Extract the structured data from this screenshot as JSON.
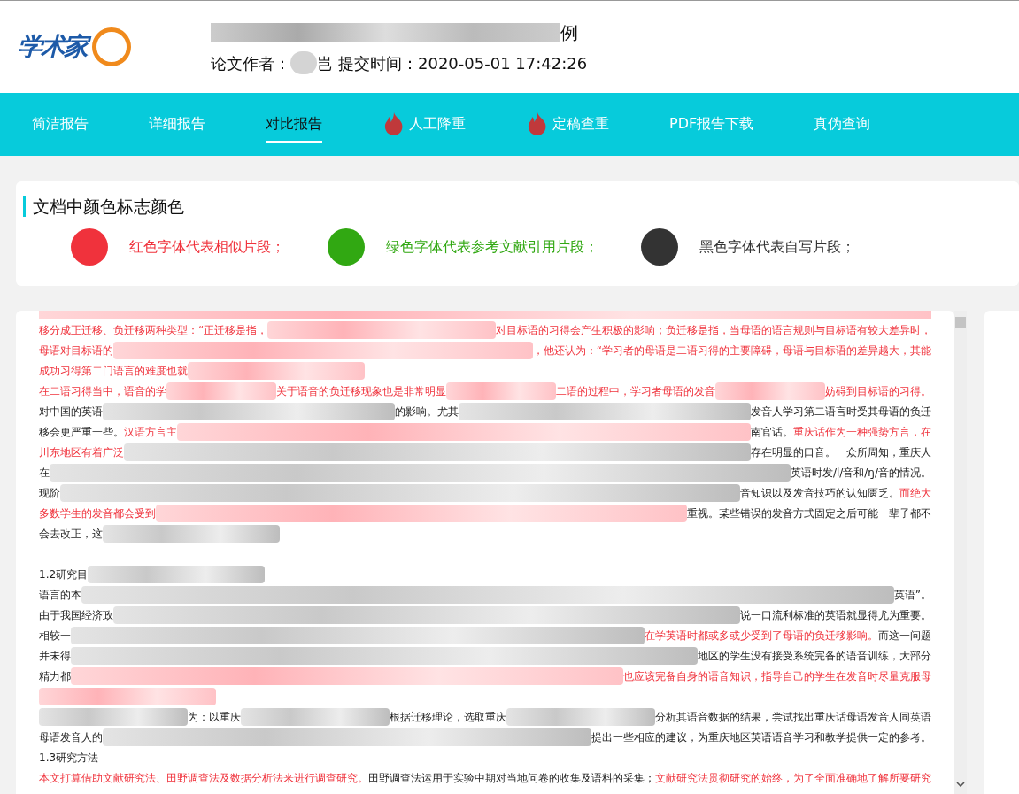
{
  "logo": {
    "text": "学术家"
  },
  "header": {
    "title_tail": "例",
    "author_label": "论文作者：",
    "author_tail": "岂",
    "submit_label": "提交时间：2020-05-01 17:42:26"
  },
  "nav": [
    {
      "label": "简洁报告",
      "selected": false,
      "hot": false
    },
    {
      "label": "详细报告",
      "selected": false,
      "hot": false
    },
    {
      "label": "对比报告",
      "selected": true,
      "hot": false
    },
    {
      "label": "人工降重",
      "selected": false,
      "hot": true
    },
    {
      "label": "定稿查重",
      "selected": false,
      "hot": true
    },
    {
      "label": "PDF报告下载",
      "selected": false,
      "hot": false
    },
    {
      "label": "真伪查询",
      "selected": false,
      "hot": false
    }
  ],
  "legend": {
    "title": "文档中颜色标志颜色",
    "items": [
      {
        "color": "#f0323c",
        "text": "红色字体代表相似片段；"
      },
      {
        "color": "#31a812",
        "text": "绿色字体代表参考文献引用片段；"
      },
      {
        "color": "#333333",
        "text": "黑色字体代表自写片段；"
      }
    ]
  },
  "document": {
    "lines": [
      {
        "kind": "text",
        "segments": [
          {
            "kind": "similar",
            "text": "移分成正迁移、负迁移两种类型：“正迁移是指，"
          },
          {
            "kind": "similar_redaction"
          },
          {
            "kind": "similar",
            "text": "对目标语的习得会产生积极的影响；负迁移是指，当母语的语言规则与目标语有较大差异时，"
          }
        ]
      },
      {
        "kind": "text",
        "segments": [
          {
            "kind": "similar",
            "text": "母语对目标语的"
          },
          {
            "kind": "similar_redaction"
          },
          {
            "kind": "similar",
            "text": "，他还认为：“学习者的母语是二语习得的主要障碍，母语与目标语的差异越大，其能"
          }
        ]
      },
      {
        "kind": "text",
        "segments": [
          {
            "kind": "similar",
            "text": "成功习得第二门语言的难度也就"
          },
          {
            "kind": "similar_redaction"
          }
        ]
      },
      {
        "kind": "text",
        "segments": [
          {
            "kind": "similar",
            "text": "在二语习得当中，语音的学"
          },
          {
            "kind": "similar_redaction"
          },
          {
            "kind": "similar",
            "text": "关于语音的负迁移现象也是非常明显"
          },
          {
            "kind": "similar_redaction"
          },
          {
            "kind": "similar",
            "text": "二语的过程中，学习者母语的发音"
          },
          {
            "kind": "similar_redaction"
          },
          {
            "kind": "similar",
            "text": "妨碍到目标语的习得。"
          }
        ]
      },
      {
        "kind": "text",
        "segments": [
          {
            "kind": "own",
            "text": "对中国的英语"
          },
          {
            "kind": "own_redaction"
          },
          {
            "kind": "own",
            "text": "的影响。尤其"
          },
          {
            "kind": "own_redaction"
          },
          {
            "kind": "own",
            "text": "发音人学习第二语言时受其母语的负迁"
          }
        ]
      },
      {
        "kind": "text",
        "segments": [
          {
            "kind": "own",
            "text": "移会更严重一些。"
          },
          {
            "kind": "similar",
            "text": "汉语方言主"
          },
          {
            "kind": "similar_redaction"
          },
          {
            "kind": "own",
            "text": "南官话。"
          },
          {
            "kind": "similar",
            "text": "重庆话作为一种强势方言，在"
          }
        ]
      },
      {
        "kind": "text",
        "segments": [
          {
            "kind": "similar",
            "text": "川东地区有着广泛"
          },
          {
            "kind": "own_redaction"
          },
          {
            "kind": "own",
            "text": "存在明显的口音。　众所周知，重庆人"
          }
        ]
      },
      {
        "kind": "text",
        "segments": [
          {
            "kind": "own",
            "text": "在"
          },
          {
            "kind": "own_redaction"
          },
          {
            "kind": "own",
            "text": "英语时发/l/音和/ŋ/音的情况。"
          }
        ]
      },
      {
        "kind": "text",
        "segments": [
          {
            "kind": "own",
            "text": "现阶"
          },
          {
            "kind": "own_redaction"
          },
          {
            "kind": "own",
            "text": "音知识以及发音技巧的认知匮乏。"
          },
          {
            "kind": "similar",
            "text": "而绝大"
          }
        ]
      },
      {
        "kind": "text",
        "segments": [
          {
            "kind": "similar",
            "text": "多数学生的发音都会受到"
          },
          {
            "kind": "similar_redaction"
          },
          {
            "kind": "own",
            "text": "重视。某些错误的发音方式固定之后可能一辈子都不"
          }
        ]
      },
      {
        "kind": "text",
        "segments": [
          {
            "kind": "own",
            "text": "会去改正，这"
          },
          {
            "kind": "own_redaction"
          }
        ]
      },
      {
        "kind": "blank"
      },
      {
        "kind": "text",
        "segments": [
          {
            "kind": "own",
            "text": "1.2研究目"
          },
          {
            "kind": "own_redaction"
          }
        ]
      },
      {
        "kind": "text",
        "segments": [
          {
            "kind": "own",
            "text": "语言的本"
          },
          {
            "kind": "own_redaction"
          },
          {
            "kind": "own",
            "text": "英语”。"
          }
        ]
      },
      {
        "kind": "text",
        "segments": [
          {
            "kind": "own",
            "text": "由于我国经济政"
          },
          {
            "kind": "own_redaction"
          },
          {
            "kind": "own",
            "text": "说一口流利标准的英语就显得尤为重要。"
          }
        ]
      },
      {
        "kind": "text",
        "segments": [
          {
            "kind": "own",
            "text": "相较一"
          },
          {
            "kind": "own_redaction"
          },
          {
            "kind": "similar",
            "text": "在学英语时都或多或少受到了母语的负迁移影响。"
          },
          {
            "kind": "own",
            "text": "而这一问题"
          }
        ]
      },
      {
        "kind": "text",
        "segments": [
          {
            "kind": "own",
            "text": "并未得"
          },
          {
            "kind": "own_redaction"
          },
          {
            "kind": "own",
            "text": "地区的学生没有接受系统完备的语音训练，大部分"
          }
        ]
      },
      {
        "kind": "text",
        "segments": [
          {
            "kind": "own",
            "text": "精力都"
          },
          {
            "kind": "similar_redaction"
          },
          {
            "kind": "similar",
            "text": "也应该完备自身的语音知识，指导自己的学生在发音时尽量克服母"
          }
        ]
      },
      {
        "kind": "text",
        "segments": [
          {
            "kind": "similar_redaction"
          }
        ]
      },
      {
        "kind": "text",
        "segments": [
          {
            "kind": "own_redaction"
          },
          {
            "kind": "own",
            "text": "为：以重庆"
          },
          {
            "kind": "own_redaction"
          },
          {
            "kind": "own",
            "text": "根据迁移理论，选取重庆"
          },
          {
            "kind": "own_redaction"
          },
          {
            "kind": "own",
            "text": "分析其语音数据的结果，尝试找出重庆话母语发音人同英语"
          }
        ]
      },
      {
        "kind": "text",
        "segments": [
          {
            "kind": "own",
            "text": "母语发音人的"
          },
          {
            "kind": "own_redaction"
          },
          {
            "kind": "own",
            "text": "提出一些相应的建议，为重庆地区英语语音学习和教学提供一定的参考。"
          }
        ]
      },
      {
        "kind": "text",
        "segments": [
          {
            "kind": "own",
            "text": "1.3研究方法"
          }
        ]
      },
      {
        "kind": "text",
        "segments": [
          {
            "kind": "similar",
            "text": "本文打算借助文献研究法、田野调查法及数据分析法来进行调查研究。"
          },
          {
            "kind": "own",
            "text": "田野调查法运用于实验中期对当地问卷的收集及语料的采集；"
          },
          {
            "kind": "similar",
            "text": "文献研究法贯彻研究的始终，为了全面准确地了解所要研究"
          }
        ]
      }
    ]
  }
}
